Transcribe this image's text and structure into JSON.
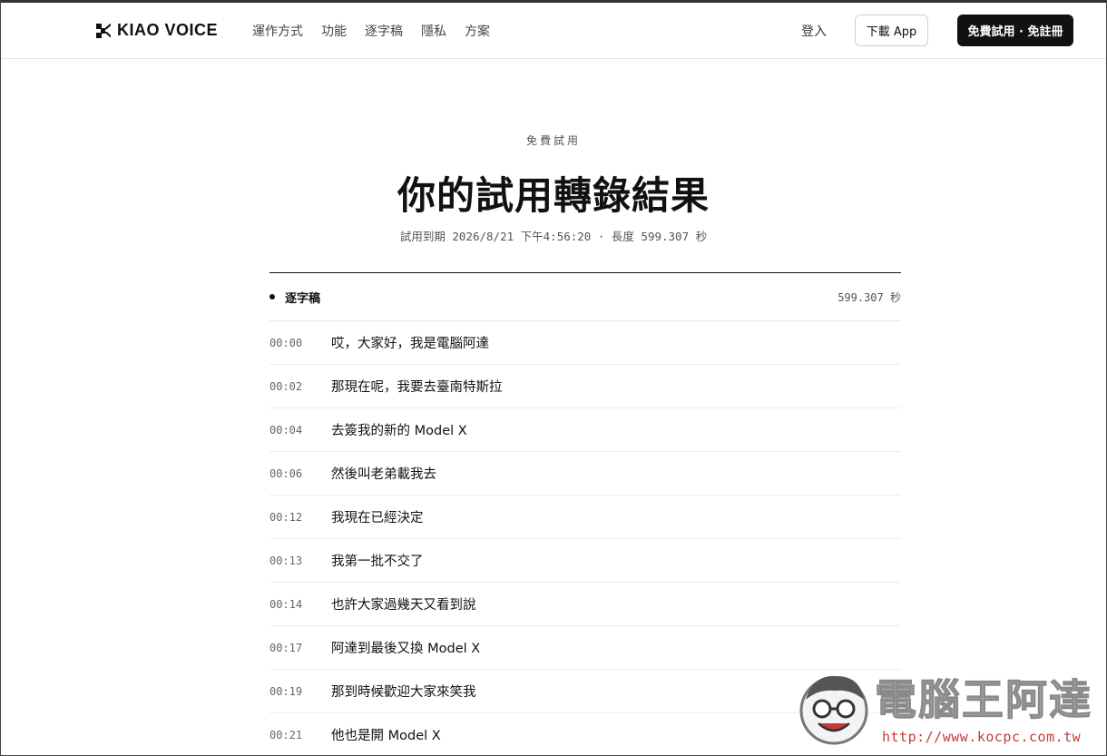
{
  "header": {
    "logo_text": "KIAO VOICE",
    "nav": [
      "運作方式",
      "功能",
      "逐字稿",
      "隱私",
      "方案"
    ],
    "login_label": "登入",
    "download_label": "下載 App",
    "trial_label": "免費試用 · 免註冊"
  },
  "hero": {
    "eyebrow": "免費試用",
    "title": "你的試用轉錄結果",
    "meta": "試用到期 2026/8/21 下午4:56:20 · 長度 599.307 秒"
  },
  "transcript": {
    "label": "逐字稿",
    "duration": "599.307 秒",
    "rows": [
      {
        "ts": "00:00",
        "text": "哎，大家好，我是電腦阿達"
      },
      {
        "ts": "00:02",
        "text": "那現在呢，我要去臺南特斯拉"
      },
      {
        "ts": "00:04",
        "text": "去簽我的新的 Model X"
      },
      {
        "ts": "00:06",
        "text": "然後叫老弟載我去"
      },
      {
        "ts": "00:12",
        "text": "我現在已經決定"
      },
      {
        "ts": "00:13",
        "text": "我第一批不交了"
      },
      {
        "ts": "00:14",
        "text": "也許大家過幾天又看到說"
      },
      {
        "ts": "00:17",
        "text": "阿達到最後又換 Model X"
      },
      {
        "ts": "00:19",
        "text": "那到時候歡迎大家來笑我"
      },
      {
        "ts": "00:21",
        "text": "他也是開 Model X"
      }
    ]
  },
  "watermark": {
    "title": "電腦王阿達",
    "url": "http://www.kocpc.com.tw"
  }
}
